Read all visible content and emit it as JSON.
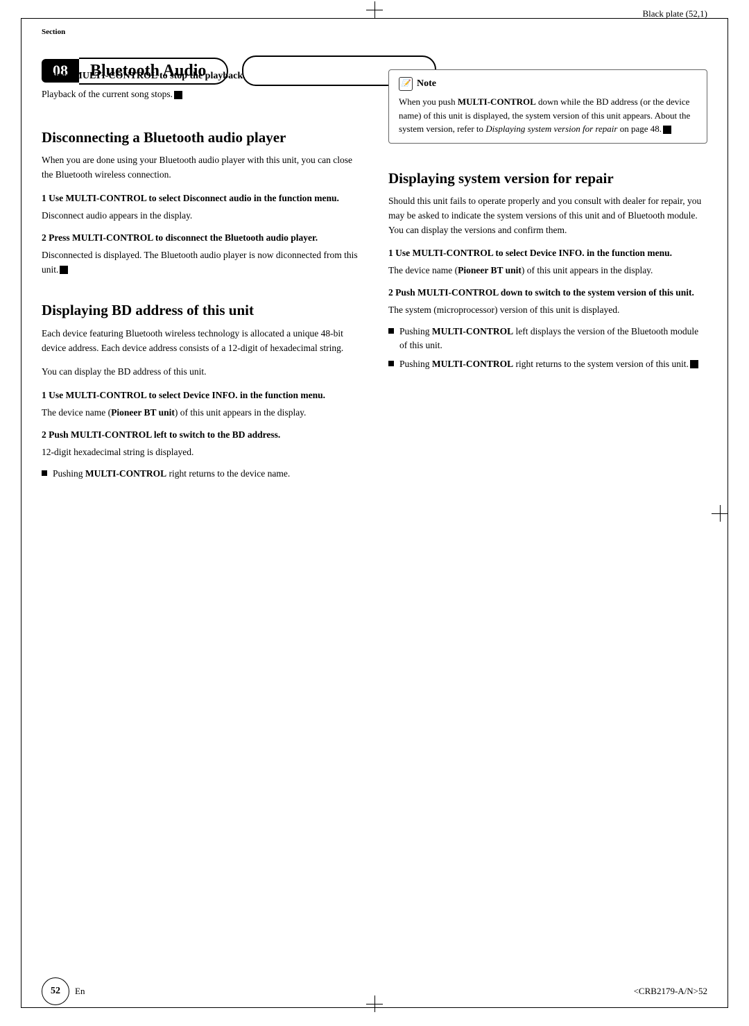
{
  "page": {
    "top_label": "Black plate (52,1)",
    "section_number": "08",
    "section_label": "Section",
    "section_title": "Bluetooth Audio",
    "page_number": "52",
    "footer_en": "En",
    "footer_code": "<CRB2179-A/N>52"
  },
  "left_column": {
    "step2_intro": {
      "heading": "2   Press MULTI-CONTROL to stop the playback.",
      "body": "Playback of the current song stops."
    },
    "disconnect_section": {
      "title": "Disconnecting a Bluetooth audio player",
      "intro": "When you are done using your Bluetooth audio player with this unit, you can close the Bluetooth wireless connection.",
      "step1": {
        "heading": "1   Use MULTI-CONTROL to select Disconnect audio in the function menu.",
        "body": "Disconnect audio appears in the display."
      },
      "step2": {
        "heading": "2   Press MULTI-CONTROL to disconnect the Bluetooth audio player.",
        "body": "Disconnected is displayed. The Bluetooth audio player is now diconnected from this unit."
      }
    },
    "bd_address_section": {
      "title": "Displaying BD address of this unit",
      "intro": "Each device featuring Bluetooth wireless technology is allocated a unique 48-bit device address. Each device address consists of a 12-digit of hexadecimal string.",
      "intro2": "You can display the BD address of this unit.",
      "step1": {
        "heading": "1   Use MULTI-CONTROL to select Device INFO. in the function menu.",
        "body": "The device name (Pioneer BT unit) of this unit appears in the display."
      },
      "step2": {
        "heading": "2   Push MULTI-CONTROL left to switch to the BD address.",
        "body": "12-digit hexadecimal string is displayed.",
        "bullet": "Pushing MULTI-CONTROL right returns to the device name."
      }
    }
  },
  "right_column": {
    "note_box": {
      "title": "Note",
      "body": "When you push MULTI-CONTROL down while the BD address (or the device name) of this unit is displayed, the system version of this unit appears. About the system version, refer to Displaying system version for repair on page 48."
    },
    "system_version_section": {
      "title": "Displaying system version for repair",
      "intro": "Should this unit fails to operate properly and you consult with dealer for repair, you may be asked to indicate the system versions of this unit and of Bluetooth module. You can display the versions and confirm them.",
      "step1": {
        "heading": "1   Use MULTI-CONTROL to select Device INFO. in the function menu.",
        "body": "The device name (Pioneer BT unit) of this unit appears in the display."
      },
      "step2": {
        "heading": "2   Push MULTI-CONTROL down to switch to the system version of this unit.",
        "body": "The system (microprocessor) version of this unit is displayed.",
        "bullet1": "Pushing MULTI-CONTROL left displays the version of the Bluetooth module of this unit.",
        "bullet2": "Pushing MULTI-CONTROL right returns to the system version of this unit."
      }
    }
  }
}
